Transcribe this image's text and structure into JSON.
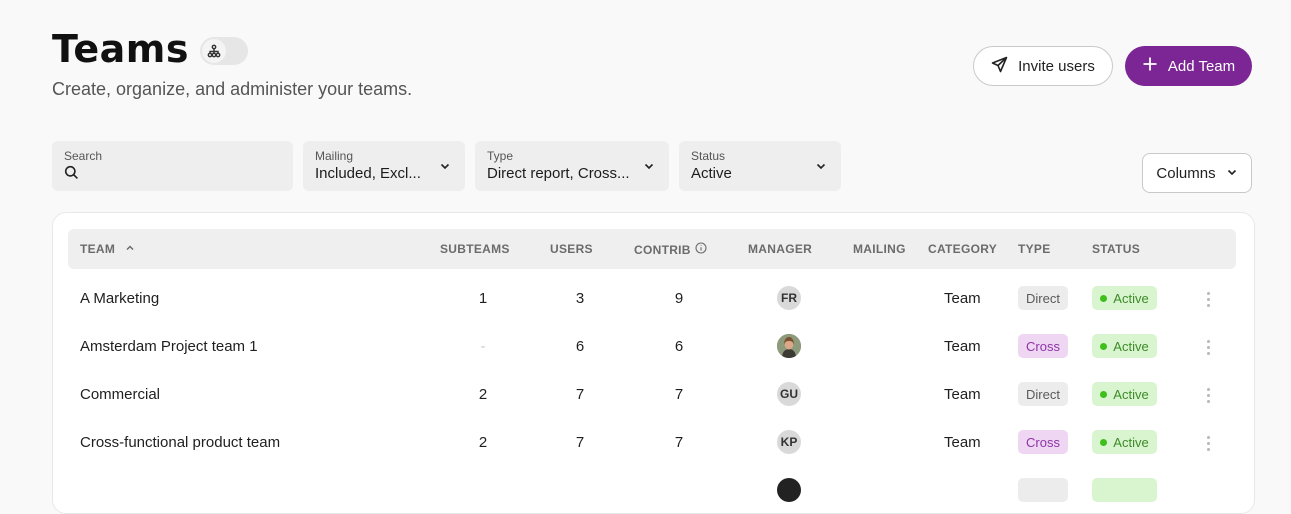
{
  "header": {
    "title": "Teams",
    "subtitle": "Create, organize, and administer your teams.",
    "invite_label": "Invite users",
    "add_label": "Add Team"
  },
  "filters": {
    "search_label": "Search",
    "mailing_label": "Mailing",
    "mailing_value": "Included, Excl...",
    "type_label": "Type",
    "type_value": "Direct report, Cross...",
    "status_label": "Status",
    "status_value": "Active",
    "columns_label": "Columns"
  },
  "table": {
    "columns": {
      "team": "TEAM",
      "subteams": "SUBTEAMS",
      "users": "USERS",
      "contrib": "CONTRIB",
      "manager": "MANAGER",
      "mailing": "MAILING",
      "category": "CATEGORY",
      "type": "TYPE",
      "status": "STATUS"
    },
    "sort": {
      "column": "team",
      "direction": "ascending"
    },
    "rows": [
      {
        "team": "A Marketing",
        "subteams": "1",
        "users": "3",
        "contrib": "9",
        "manager": "FR",
        "category": "Team",
        "type": "Direct",
        "status": "Active"
      },
      {
        "team": "Amsterdam Project team 1",
        "subteams": "-",
        "users": "6",
        "contrib": "6",
        "manager": "photo",
        "category": "Team",
        "type": "Cross",
        "status": "Active"
      },
      {
        "team": "Commercial",
        "subteams": "2",
        "users": "7",
        "contrib": "7",
        "manager": "GU",
        "category": "Team",
        "type": "Direct",
        "status": "Active"
      },
      {
        "team": "Cross-functional product team",
        "subteams": "2",
        "users": "7",
        "contrib": "7",
        "manager": "KP",
        "category": "Team",
        "type": "Cross",
        "status": "Active"
      }
    ]
  },
  "colors": {
    "accent": "#7b2694",
    "active_bg": "#d9f5cf",
    "active_dot": "#3fbf1c",
    "cross_bg": "#efd6f3",
    "cross_text": "#8e35a7",
    "direct_bg": "#ececec"
  },
  "icons": [
    "hierarchy-icon",
    "paper-plane-icon",
    "plus-icon",
    "search-icon",
    "chevron-down-icon",
    "chevron-up-icon",
    "info-icon",
    "kebab-menu-icon"
  ]
}
